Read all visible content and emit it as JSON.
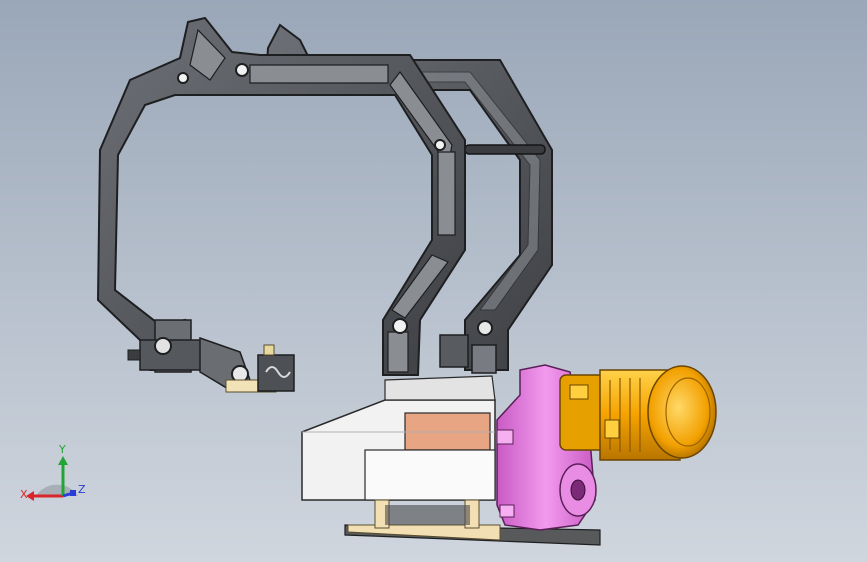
{
  "viewport": {
    "background_top": "#9aa7b8",
    "background_bottom": "#d0d6de"
  },
  "model": {
    "arm_color": "#5a5d62",
    "motor_color": "#f5a300",
    "gearbox_color": "#e57be0",
    "housing_color": "#f1f1f1",
    "pad_color": "#e7a584",
    "base_color": "#f2dfb4"
  },
  "triad": {
    "x_label": "X",
    "y_label": "Y",
    "z_label": "Z",
    "x_color": "#d8262a",
    "y_color": "#22a536",
    "z_color": "#2a3dd6"
  }
}
